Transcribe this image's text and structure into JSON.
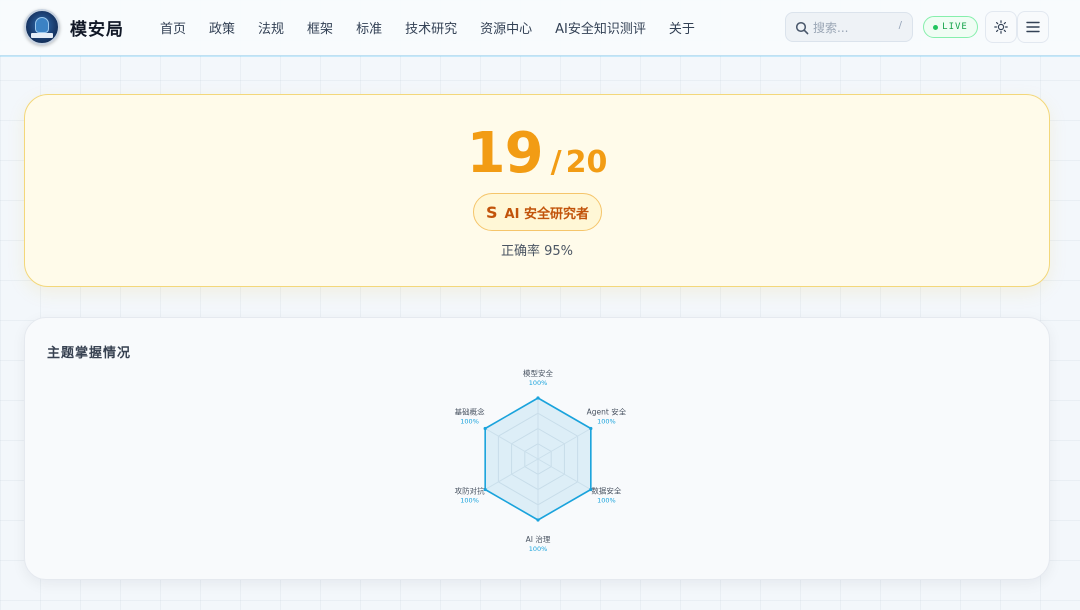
{
  "header": {
    "brand": "模安局",
    "nav": [
      "首页",
      "政策",
      "法规",
      "框架",
      "标准",
      "技术研究",
      "资源中心",
      "AI安全知识测评",
      "关于"
    ],
    "search": {
      "placeholder": "搜索...",
      "shortcut": "/"
    },
    "live_label": "LIVE",
    "icons": [
      "search-icon",
      "sun-icon",
      "menu-icon"
    ]
  },
  "score": {
    "value": "19",
    "separator": "/",
    "total": "20",
    "rank_letter": "S",
    "rank_title": "AI 安全研究者",
    "accuracy_text": "正确率 95%"
  },
  "topics": {
    "title": "主题掌握情况"
  },
  "colors": {
    "accent_orange": "#f29c14",
    "radar_stroke": "#1aa3dc",
    "live_green": "#16a34a"
  },
  "chart_data": {
    "type": "radar",
    "axes": [
      {
        "name": "模型安全",
        "value": 100,
        "label": "100%"
      },
      {
        "name": "Agent 安全",
        "value": 100,
        "label": "100%"
      },
      {
        "name": "数据安全",
        "value": 100,
        "label": "100%"
      },
      {
        "name": "AI 治理",
        "value": 100,
        "label": "100%"
      },
      {
        "name": "攻防对抗",
        "value": 100,
        "label": "100%"
      },
      {
        "name": "基础概念",
        "value": 100,
        "label": "100%"
      }
    ],
    "range": [
      0,
      100
    ],
    "grid_levels": 4
  }
}
